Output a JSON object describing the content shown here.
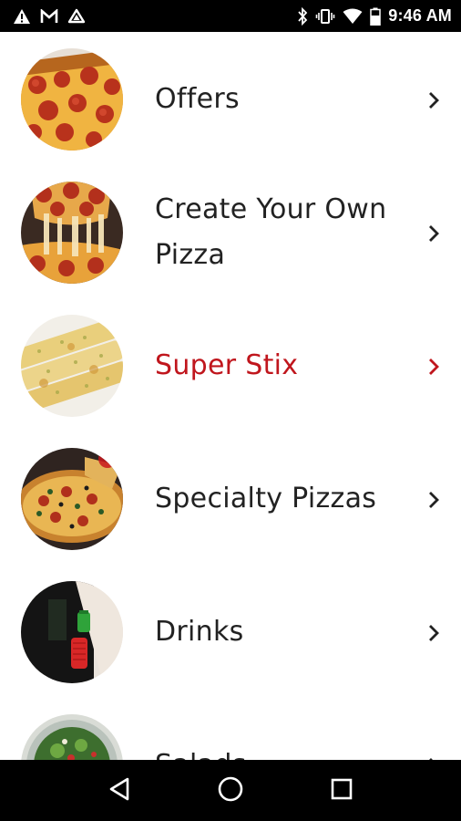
{
  "status_bar": {
    "time": "9:46 AM",
    "left_icons": [
      "warning-icon",
      "gmail-icon",
      "drive-icon"
    ],
    "right_icons": [
      "bluetooth-icon",
      "vibrate-icon",
      "wifi-icon",
      "battery-icon"
    ]
  },
  "menu": {
    "items": [
      {
        "label": "Offers",
        "thumb": "pepperoni-pizza-slice",
        "active": false
      },
      {
        "label": "Create Your Own Pizza",
        "thumb": "cheese-pull-pizza",
        "active": false
      },
      {
        "label": "Super Stix",
        "thumb": "breadsticks",
        "active": true
      },
      {
        "label": "Specialty Pizzas",
        "thumb": "specialty-pizza",
        "active": false
      },
      {
        "label": "Drinks",
        "thumb": "soda-bottles",
        "active": false
      },
      {
        "label": "Salads",
        "thumb": "salad-bowl",
        "active": false
      }
    ]
  },
  "colors": {
    "active": "#c0161d",
    "text": "#222222",
    "bars": "#000000"
  },
  "nav_bar": {
    "buttons": [
      "back-icon",
      "home-icon",
      "recents-icon"
    ]
  }
}
